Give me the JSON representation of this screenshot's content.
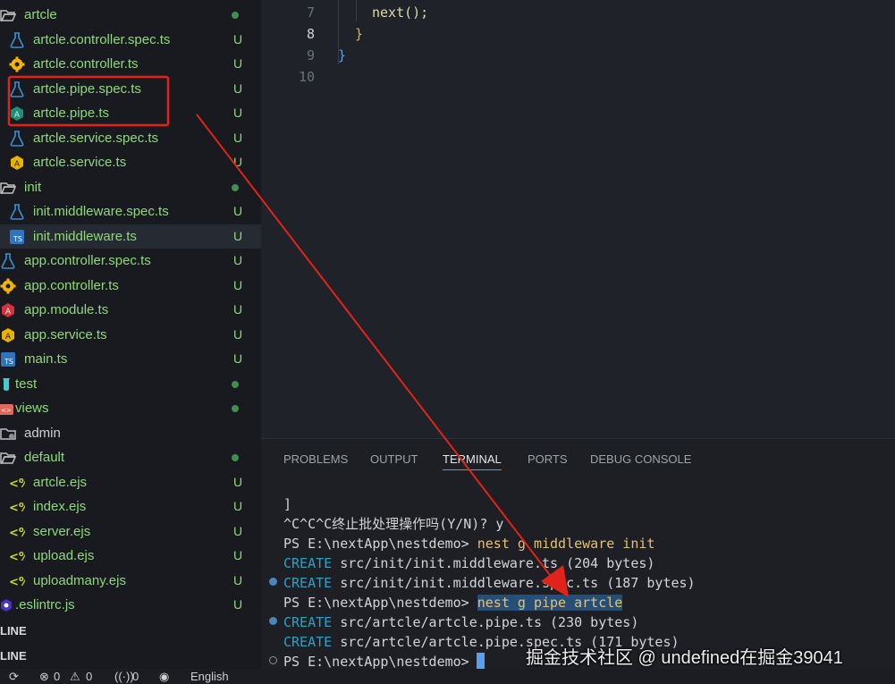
{
  "explorer": {
    "items": [
      {
        "name": "artcle",
        "kind": "folder-open",
        "indent": 0,
        "status": "dot"
      },
      {
        "name": "artcle.controller.spec.ts",
        "icon": "flask-icon",
        "indent": 1,
        "status": "U"
      },
      {
        "name": "artcle.controller.ts",
        "icon": "gear-icon",
        "indent": 1,
        "status": "U"
      },
      {
        "name": "artcle.pipe.spec.ts",
        "icon": "flask-icon",
        "indent": 1,
        "status": "U"
      },
      {
        "name": "artcle.pipe.ts",
        "icon": "pipe-icon",
        "indent": 1,
        "status": "U"
      },
      {
        "name": "artcle.service.spec.ts",
        "icon": "flask-icon",
        "indent": 1,
        "status": "U"
      },
      {
        "name": "artcle.service.ts",
        "icon": "service-icon",
        "indent": 1,
        "status": "U"
      },
      {
        "name": "init",
        "kind": "folder-open",
        "indent": 0,
        "status": "dot"
      },
      {
        "name": "init.middleware.spec.ts",
        "icon": "flask-icon",
        "indent": 1,
        "status": "U"
      },
      {
        "name": "init.middleware.ts",
        "icon": "ts-icon",
        "indent": 1,
        "status": "U",
        "selected": true
      },
      {
        "name": "app.controller.spec.ts",
        "icon": "flask-icon",
        "indent": 0,
        "status": "U"
      },
      {
        "name": "app.controller.ts",
        "icon": "gear-icon",
        "indent": 0,
        "status": "U"
      },
      {
        "name": "app.module.ts",
        "icon": "module-icon",
        "indent": 0,
        "status": "U"
      },
      {
        "name": "app.service.ts",
        "icon": "service-icon",
        "indent": 0,
        "status": "U"
      },
      {
        "name": "main.ts",
        "icon": "ts-icon",
        "indent": 0,
        "status": "U"
      },
      {
        "name": "test",
        "kind": "folder",
        "icon": "test-folder-icon",
        "indent": -1,
        "status": "dot"
      },
      {
        "name": "views",
        "kind": "folder",
        "icon": "views-folder-icon",
        "indent": -1,
        "status": "dot"
      },
      {
        "name": "admin",
        "kind": "folder",
        "icon": "folder-icon",
        "indent": 0,
        "status": "",
        "plain": true
      },
      {
        "name": "default",
        "kind": "folder-open",
        "indent": 0,
        "status": "dot"
      },
      {
        "name": "artcle.ejs",
        "icon": "ejs-icon",
        "indent": 1,
        "status": "U"
      },
      {
        "name": "index.ejs",
        "icon": "ejs-icon",
        "indent": 1,
        "status": "U"
      },
      {
        "name": "server.ejs",
        "icon": "ejs-icon",
        "indent": 1,
        "status": "U"
      },
      {
        "name": "upload.ejs",
        "icon": "ejs-icon",
        "indent": 1,
        "status": "U"
      },
      {
        "name": "uploadmany.ejs",
        "icon": "ejs-icon",
        "indent": 1,
        "status": "U"
      },
      {
        "name": ".eslintrc.js",
        "icon": "eslint-icon",
        "indent": -1,
        "status": "U"
      }
    ],
    "section_1": "LINE",
    "section_2": "LINE"
  },
  "editor": {
    "lines": [
      {
        "num": "7",
        "text": "next();",
        "indent": 2
      },
      {
        "num": "8",
        "text": "}",
        "indent": 1,
        "active": true
      },
      {
        "num": "9",
        "text": "}",
        "indent": 0
      },
      {
        "num": "10",
        "text": "",
        "indent": 0
      }
    ]
  },
  "panel": {
    "tabs": [
      "PROBLEMS",
      "OUTPUT",
      "TERMINAL",
      "PORTS",
      "DEBUG CONSOLE"
    ],
    "active_tab": "TERMINAL",
    "terminal": {
      "l1": "]",
      "l2": "^C^C^C终止批处理操作吗(Y/N)? y",
      "l3_prompt": "PS E:\\nextApp\\nestdemo> ",
      "l3_cmd": "nest g middleware init",
      "l4_kw": "CREATE",
      "l4_rest": " src/init/init.middleware.ts (204 bytes)",
      "l5_kw": "CREATE",
      "l5_rest": " src/init/init.middleware.spec.ts (187 bytes)",
      "l6_prompt": "PS E:\\nextApp\\nestdemo> ",
      "l6_cmd": "nest g pipe artcle",
      "l7_kw": "CREATE",
      "l7_rest": " src/artcle/artcle.pipe.ts (230 bytes)",
      "l8_kw": "CREATE",
      "l8_rest": " src/artcle/artcle.pipe.spec.ts (171 bytes)",
      "l9_prompt": "PS E:\\nextApp\\nestdemo> "
    }
  },
  "status": {
    "errors": "0",
    "warnings": "0",
    "ports": "0",
    "language": "English"
  },
  "watermark": "掘金技术社区 @ undefined在掘金39041",
  "colors": {
    "highlight_box": "#e2231a",
    "arrow": "#e2231a",
    "untracked": "#8fd97a"
  }
}
